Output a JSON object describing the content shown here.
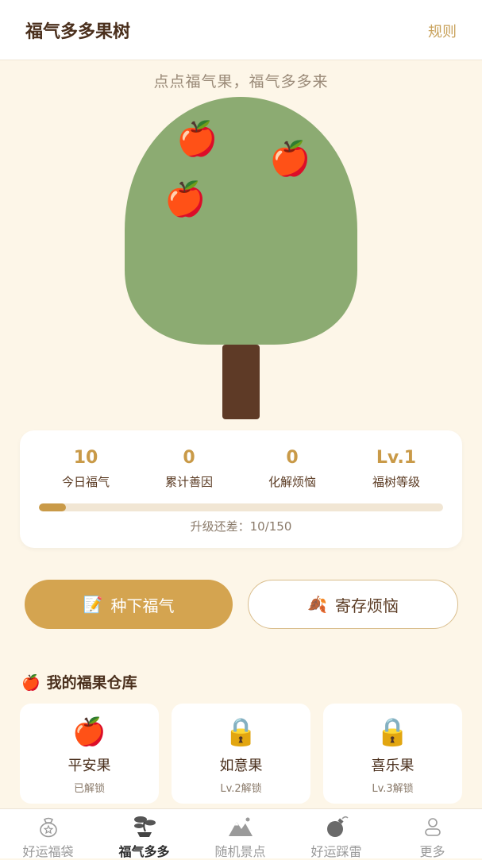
{
  "header": {
    "title": "福气多多果树",
    "rules_label": "规则"
  },
  "tagline": "点点福气果，福气多多来",
  "colors": {
    "accent": "#d4a450",
    "canopy": "#8cab72",
    "trunk": "#5e3a26",
    "background": "#fdf6e8"
  },
  "tree": {
    "fruit_icon": "apple",
    "fruits": [
      {
        "name": "apple-1",
        "glyph": "🍎"
      },
      {
        "name": "apple-2",
        "glyph": "🍎"
      },
      {
        "name": "apple-3",
        "glyph": "🍎"
      }
    ]
  },
  "stats": {
    "items": [
      {
        "value": "10",
        "label": "今日福气"
      },
      {
        "value": "0",
        "label": "累计善因"
      },
      {
        "value": "0",
        "label": "化解烦恼"
      },
      {
        "value": "Lv.1",
        "label": "福树等级"
      }
    ],
    "progress_fraction": 0.0667,
    "progress_text": "升级还差：10/150"
  },
  "actions": {
    "plant": {
      "icon": "📝",
      "label": "种下福气"
    },
    "store": {
      "icon": "🍂",
      "label": "寄存烦恼"
    }
  },
  "warehouse": {
    "title_icon": "🍎",
    "title": "我的福果仓库",
    "items": [
      {
        "icon": "🍎",
        "name": "平安果",
        "status": "已解锁"
      },
      {
        "icon": "🔒",
        "name": "如意果",
        "status": "Lv.2解锁"
      },
      {
        "icon": "🔒",
        "name": "喜乐果",
        "status": "Lv.3解锁"
      }
    ]
  },
  "tabbar": {
    "active_index": 1,
    "items": [
      {
        "label": "好运福袋",
        "icon": "lucky-bag-icon"
      },
      {
        "label": "福气多多",
        "icon": "bonsai-tree-icon"
      },
      {
        "label": "随机景点",
        "icon": "mountain-icon"
      },
      {
        "label": "好运踩雷",
        "icon": "bomb-icon"
      },
      {
        "label": "更多",
        "icon": "person-icon"
      }
    ]
  }
}
